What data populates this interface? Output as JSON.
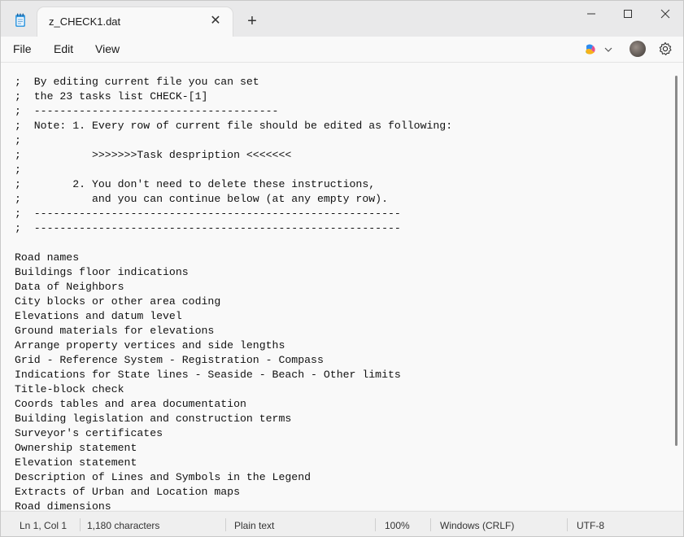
{
  "window": {
    "tab_title": "z_CHECK1.dat",
    "new_tab": "+",
    "tab_close": "✕"
  },
  "menu": {
    "file": "File",
    "edit": "Edit",
    "view": "View"
  },
  "editor": {
    "lines": [
      ";  By editing current file you can set",
      ";  the 23 tasks list CHECK-[1]",
      ";  --------------------------------------",
      ";  Note: 1. Every row of current file should be edited as following:",
      ";",
      ";           >>>>>>>Task despription <<<<<<<",
      ";",
      ";        2. You don't need to delete these instructions,",
      ";           and you can continue below (at any empty row).",
      ";  ---------------------------------------------------------",
      ";  ---------------------------------------------------------",
      "",
      "Road names",
      "Buildings floor indications",
      "Data of Neighbors",
      "City blocks or other area coding",
      "Elevations and datum level",
      "Ground materials for elevations",
      "Arrange property vertices and side lengths",
      "Grid - Reference System - Registration - Compass",
      "Indications for State lines - Seaside - Beach - Other limits",
      "Title-block check",
      "Coords tables and area documentation",
      "Building legislation and construction terms",
      "Surveyor's certificates",
      "Ownership statement",
      "Elevation statement",
      "Description of Lines and Symbols in the Legend",
      "Extracts of Urban and Location maps",
      "Road dimensions"
    ]
  },
  "status": {
    "position": "Ln 1, Col 1",
    "characters": "1,180 characters",
    "format": "Plain text",
    "zoom": "100%",
    "line_ending": "Windows (CRLF)",
    "encoding": "UTF-8"
  }
}
